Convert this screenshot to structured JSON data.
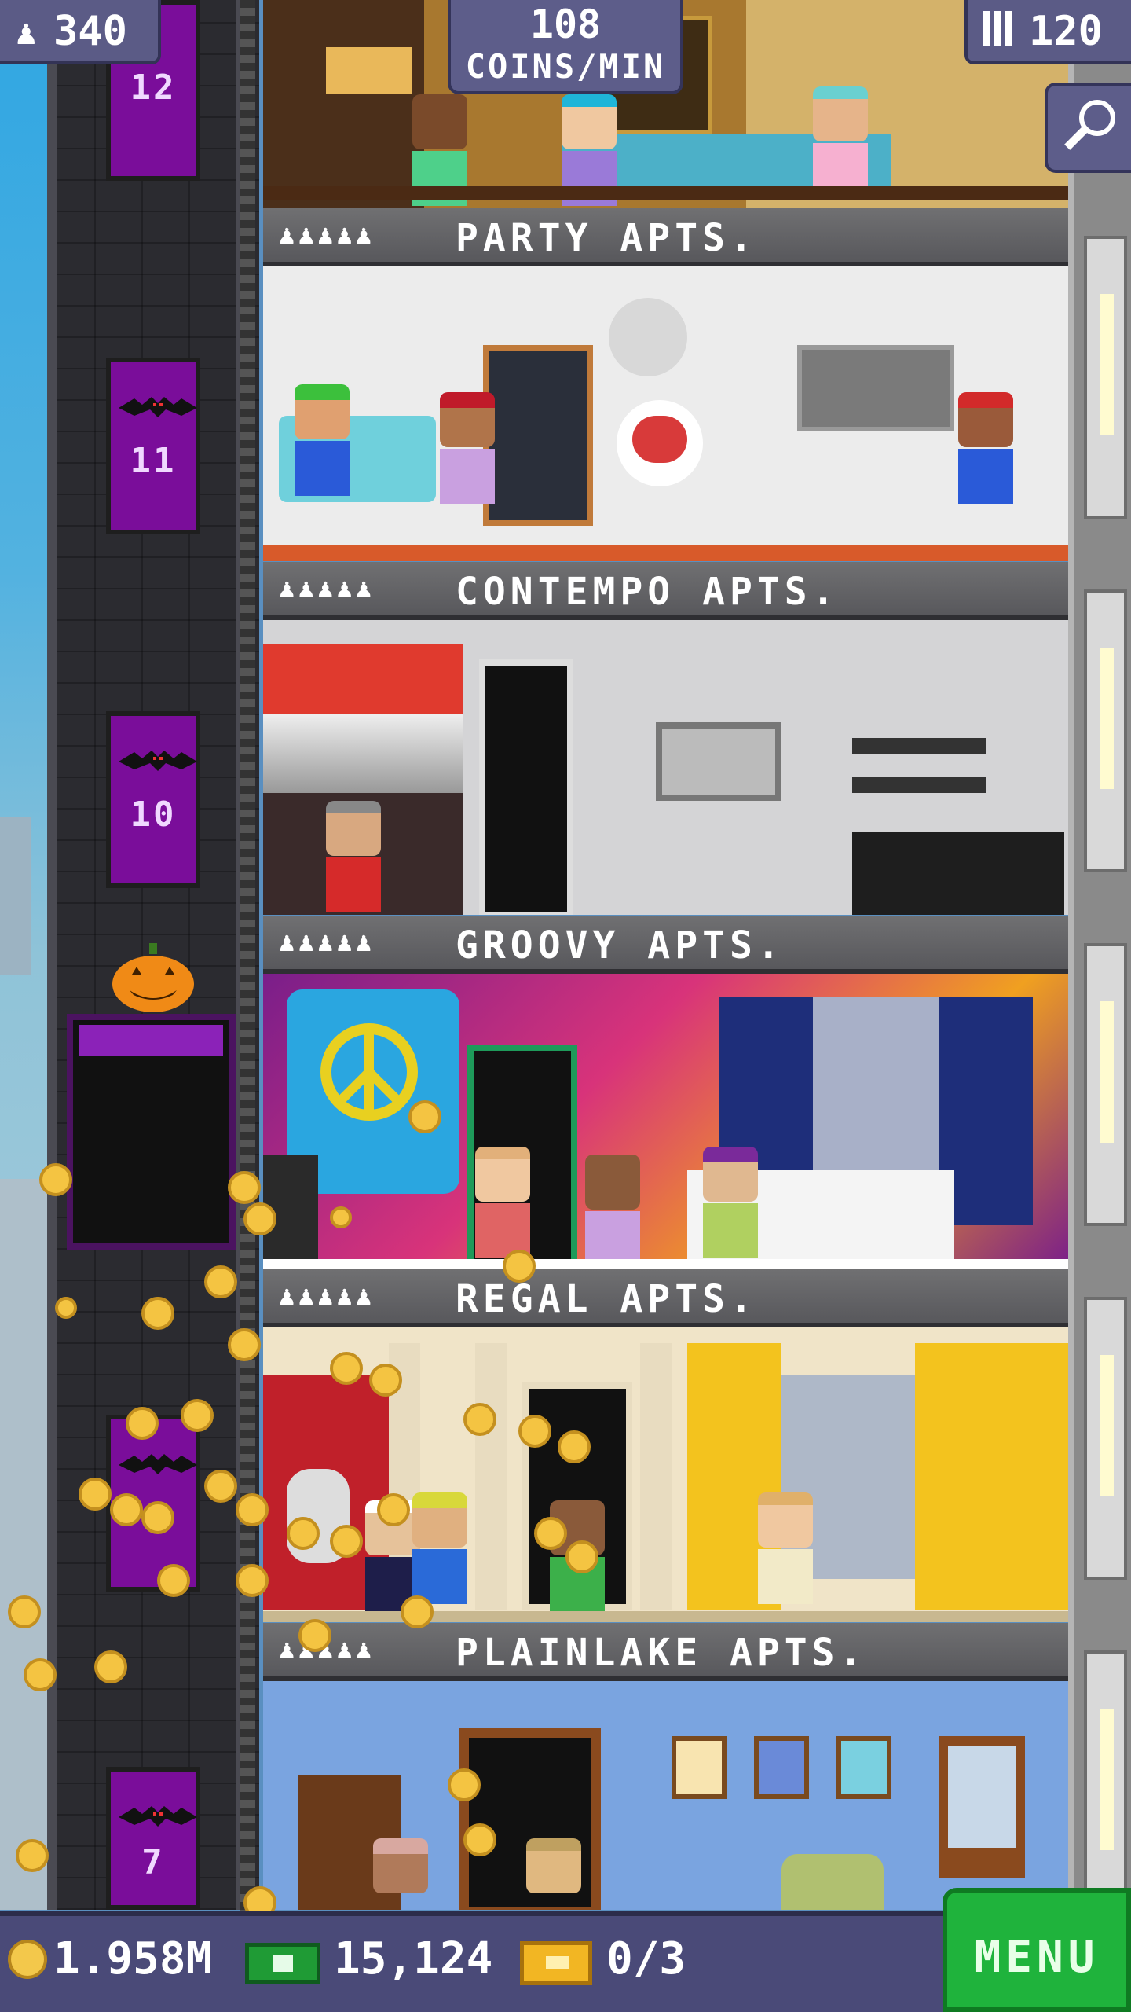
{
  "hud": {
    "population": "340",
    "coins_per_min_value": "108",
    "coins_per_min_label": "COINS/MIN",
    "floors": "120"
  },
  "elevator": {
    "floor_numbers": [
      "12",
      "11",
      "10",
      "7"
    ]
  },
  "floors": [
    {
      "name": "PARTY APTS.",
      "stars": "♟♟♟♟♟"
    },
    {
      "name": "CONTEMPO APTS.",
      "stars": "♟♟♟♟♟"
    },
    {
      "name": "GROOVY APTS.",
      "stars": "♟♟♟♟♟"
    },
    {
      "name": "REGAL APTS.",
      "stars": "♟♟♟♟♟"
    },
    {
      "name": "PLAINLAKE APTS.",
      "stars": "♟♟♟♟♟"
    }
  ],
  "bottom_bar": {
    "coins": "1.958M",
    "bux": "15,124",
    "tickets": "0/3",
    "menu_label": "MENU"
  },
  "colors": {
    "hud_bg": "#5b5b86",
    "menu_green": "#1fb33c",
    "elevator_purple": "#7a0d9a",
    "coin_gold": "#f4c442"
  },
  "icons": {
    "population": "person-icon",
    "floors": "building-icon",
    "zoom": "magnifier-icon",
    "coin": "coin-icon",
    "bux": "bux-icon",
    "ticket": "vip-ticket-icon"
  }
}
